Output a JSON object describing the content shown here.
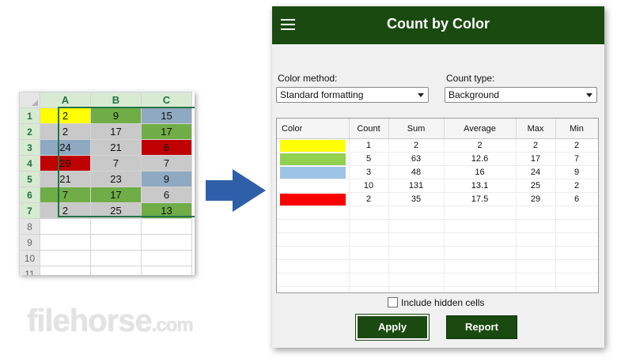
{
  "sheet": {
    "columns": [
      "A",
      "B",
      "C"
    ],
    "rows": [
      {
        "num": "1",
        "cells": [
          {
            "v": "2",
            "c": "#ffff00"
          },
          {
            "v": "9",
            "c": "#70ad47"
          },
          {
            "v": "15",
            "c": "#8ea9c1"
          }
        ]
      },
      {
        "num": "2",
        "cells": [
          {
            "v": "2",
            "c": "#c9c9c9"
          },
          {
            "v": "17",
            "c": "#c9c9c9"
          },
          {
            "v": "17",
            "c": "#70ad47"
          }
        ]
      },
      {
        "num": "3",
        "cells": [
          {
            "v": "24",
            "c": "#8ea9c1"
          },
          {
            "v": "21",
            "c": "#c9c9c9"
          },
          {
            "v": "6",
            "c": "#c00000"
          }
        ]
      },
      {
        "num": "4",
        "cells": [
          {
            "v": "29",
            "c": "#c00000"
          },
          {
            "v": "7",
            "c": "#c9c9c9"
          },
          {
            "v": "7",
            "c": "#c9c9c9"
          }
        ]
      },
      {
        "num": "5",
        "cells": [
          {
            "v": "21",
            "c": "#c9c9c9"
          },
          {
            "v": "23",
            "c": "#c9c9c9"
          },
          {
            "v": "9",
            "c": "#8ea9c1"
          }
        ]
      },
      {
        "num": "6",
        "cells": [
          {
            "v": "7",
            "c": "#70ad47"
          },
          {
            "v": "17",
            "c": "#70ad47"
          },
          {
            "v": "6",
            "c": "#c9c9c9"
          }
        ]
      },
      {
        "num": "7",
        "cells": [
          {
            "v": "2",
            "c": "#c9c9c9"
          },
          {
            "v": "25",
            "c": "#c9c9c9"
          },
          {
            "v": "13",
            "c": "#70ad47"
          }
        ]
      },
      {
        "num": "8",
        "cells": [
          {
            "v": "",
            "c": ""
          },
          {
            "v": "",
            "c": ""
          },
          {
            "v": "",
            "c": ""
          }
        ]
      },
      {
        "num": "9",
        "cells": [
          {
            "v": "",
            "c": ""
          },
          {
            "v": "",
            "c": ""
          },
          {
            "v": "",
            "c": ""
          }
        ]
      },
      {
        "num": "10",
        "cells": [
          {
            "v": "",
            "c": ""
          },
          {
            "v": "",
            "c": ""
          },
          {
            "v": "",
            "c": ""
          }
        ]
      },
      {
        "num": "11",
        "cells": [
          {
            "v": "",
            "c": ""
          },
          {
            "v": "",
            "c": ""
          },
          {
            "v": "",
            "c": ""
          }
        ]
      }
    ]
  },
  "watermark": {
    "name": "filehorse",
    "domain": ".com"
  },
  "dialog": {
    "title": "Count by Color",
    "color_method_label": "Color method:",
    "color_method_value": "Standard formatting",
    "count_type_label": "Count type:",
    "count_type_value": "Background",
    "grid_headers": [
      "Color",
      "Count",
      "Sum",
      "Average",
      "Max",
      "Min"
    ],
    "grid_rows": [
      {
        "color": "#ffff00",
        "count": "1",
        "sum": "2",
        "average": "2",
        "max": "2",
        "min": "2"
      },
      {
        "color": "#92d050",
        "count": "5",
        "sum": "63",
        "average": "12.6",
        "max": "17",
        "min": "7"
      },
      {
        "color": "#9dc3e6",
        "count": "3",
        "sum": "48",
        "average": "16",
        "max": "24",
        "min": "9"
      },
      {
        "color": "",
        "count": "10",
        "sum": "131",
        "average": "13.1",
        "max": "25",
        "min": "2"
      },
      {
        "color": "#ff0000",
        "count": "2",
        "sum": "35",
        "average": "17.5",
        "max": "29",
        "min": "6"
      }
    ],
    "empty_rows": 7,
    "include_hidden_label": "Include hidden cells",
    "include_hidden_checked": false,
    "apply_label": "Apply",
    "report_label": "Report"
  },
  "colors": {
    "accent": "#1a4a10",
    "excel_green": "#217346",
    "arrow": "#2e5fa8"
  }
}
